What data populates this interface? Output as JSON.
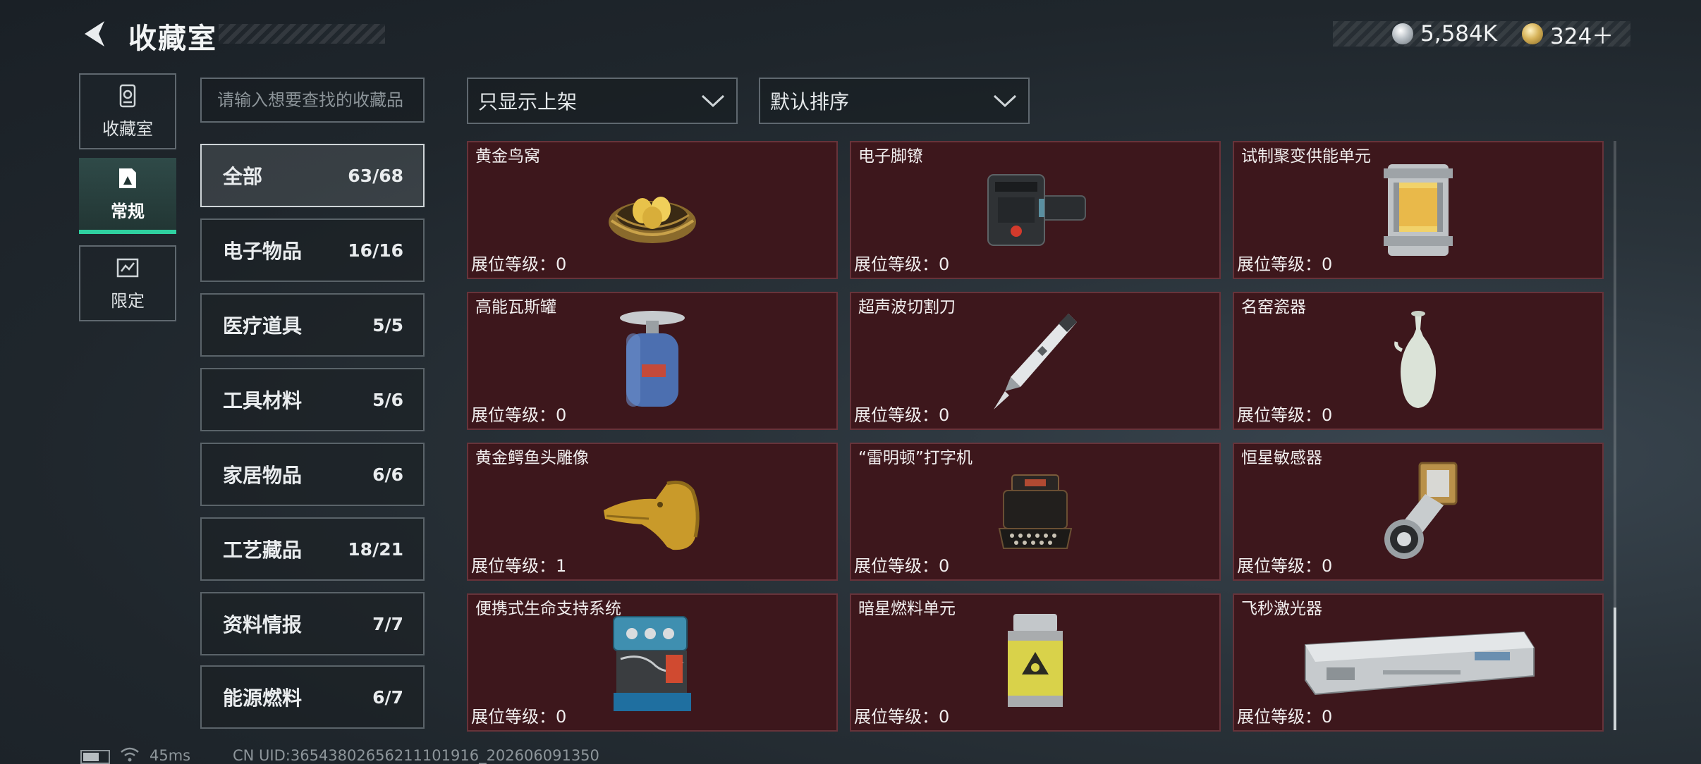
{
  "header": {
    "title": "收藏室",
    "currency": [
      {
        "icon": "silver-coin-icon",
        "value": "5,584K"
      },
      {
        "icon": "gold-coin-icon",
        "value": "324＋"
      }
    ]
  },
  "rail": [
    {
      "label": "收藏室",
      "icon": "vault-icon",
      "active": false
    },
    {
      "label": "常规",
      "icon": "regular-collection-icon",
      "active": true
    },
    {
      "label": "限定",
      "icon": "limited-collection-icon",
      "active": false
    }
  ],
  "search": {
    "placeholder": "请输入想要查找的收藏品",
    "value": ""
  },
  "filters": {
    "display": "只显示上架",
    "sort": "默认排序"
  },
  "categories": [
    {
      "label": "全部",
      "count": "63/68",
      "active": true
    },
    {
      "label": "电子物品",
      "count": "16/16"
    },
    {
      "label": "医疗道具",
      "count": "5/5"
    },
    {
      "label": "工具材料",
      "count": "5/6"
    },
    {
      "label": "家居物品",
      "count": "6/6"
    },
    {
      "label": "工艺藏品",
      "count": "18/21"
    },
    {
      "label": "资料情报",
      "count": "7/7"
    },
    {
      "label": "能源燃料",
      "count": "6/7"
    }
  ],
  "items": [
    {
      "name": "黄金鸟窝",
      "level": "展位等级：0",
      "icon": "golden-nest-icon"
    },
    {
      "name": "电子脚镣",
      "level": "展位等级：0",
      "icon": "electronic-anklet-icon"
    },
    {
      "name": "试制聚变供能单元",
      "level": "展位等级：0",
      "icon": "fusion-unit-icon"
    },
    {
      "name": "高能瓦斯罐",
      "level": "展位等级：0",
      "icon": "gas-canister-icon"
    },
    {
      "name": "超声波切割刀",
      "level": "展位等级：0",
      "icon": "ultrasonic-cutter-icon"
    },
    {
      "name": "名窑瓷器",
      "level": "展位等级：0",
      "icon": "porcelain-vase-icon"
    },
    {
      "name": "黄金鳄鱼头雕像",
      "level": "展位等级：1",
      "icon": "golden-crocodile-icon"
    },
    {
      "name": "“雷明顿”打字机",
      "level": "展位等级：0",
      "icon": "typewriter-icon"
    },
    {
      "name": "恒星敏感器",
      "level": "展位等级：0",
      "icon": "star-sensor-icon"
    },
    {
      "name": "便携式生命支持系统",
      "level": "展位等级：0",
      "icon": "life-support-icon"
    },
    {
      "name": "暗星燃料单元",
      "level": "展位等级：0",
      "icon": "fuel-cell-icon"
    },
    {
      "name": "飞秒激光器",
      "level": "展位等级：0",
      "icon": "femtosecond-laser-icon"
    }
  ],
  "status": {
    "ping": "45ms",
    "uid": "CN UID:36543802656211101916_202606091350"
  }
}
